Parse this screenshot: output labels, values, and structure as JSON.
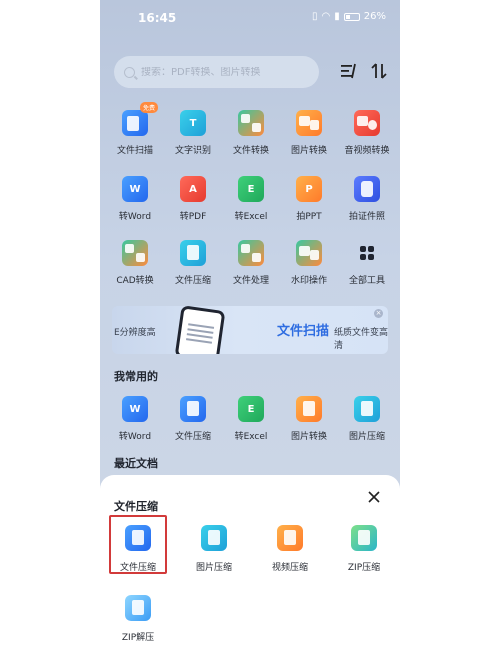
{
  "status": {
    "time": "16:45",
    "battery": "26%"
  },
  "search": {
    "placeholder": "搜索：PDF转换、图片转换"
  },
  "tools_row1": [
    {
      "label": "文件扫描",
      "icon": "scan-icon",
      "color": "ic-blue",
      "badge": "免费"
    },
    {
      "label": "文字识别",
      "icon": "text-recognition-icon",
      "color": "ic-cyan",
      "glyph": "T"
    },
    {
      "label": "文件转换",
      "icon": "file-convert-icon",
      "color": "ic-multi"
    },
    {
      "label": "图片转换",
      "icon": "image-convert-icon",
      "color": "ic-orange"
    },
    {
      "label": "音视频转换",
      "icon": "av-convert-icon",
      "color": "ic-red"
    }
  ],
  "tools_row2": [
    {
      "label": "转Word",
      "icon": "word-icon",
      "color": "ic-blue",
      "glyph": "W"
    },
    {
      "label": "转PDF",
      "icon": "pdf-icon",
      "color": "ic-red",
      "glyph": "A"
    },
    {
      "label": "转Excel",
      "icon": "excel-icon",
      "color": "ic-green",
      "glyph": "E"
    },
    {
      "label": "拍PPT",
      "icon": "ppt-icon",
      "color": "ic-orange",
      "glyph": "P"
    },
    {
      "label": "拍证件照",
      "icon": "id-photo-icon",
      "color": "ic-navy"
    }
  ],
  "tools_row3": [
    {
      "label": "CAD转换",
      "icon": "cad-icon",
      "color": "ic-multi"
    },
    {
      "label": "文件压缩",
      "icon": "compress-icon",
      "color": "ic-cyan"
    },
    {
      "label": "文件处理",
      "icon": "file-process-icon",
      "color": "ic-multi"
    },
    {
      "label": "水印操作",
      "icon": "watermark-icon",
      "color": "ic-multi"
    },
    {
      "label": "全部工具",
      "icon": "all-tools-icon",
      "color": "ic-dark"
    }
  ],
  "banner": {
    "left_text": "E分辨度高",
    "title": "文件扫描",
    "subtitle": "纸质文件变高清"
  },
  "favorites": {
    "title": "我常用的",
    "items": [
      {
        "label": "转Word",
        "icon": "word-icon",
        "color": "ic-blue",
        "glyph": "W"
      },
      {
        "label": "文件压缩",
        "icon": "compress-icon",
        "color": "ic-blue"
      },
      {
        "label": "转Excel",
        "icon": "excel-icon",
        "color": "ic-green",
        "glyph": "E"
      },
      {
        "label": "图片转换",
        "icon": "image-convert-icon",
        "color": "ic-orange"
      },
      {
        "label": "图片压缩",
        "icon": "image-compress-icon",
        "color": "ic-cyan"
      }
    ]
  },
  "recent": {
    "title": "最近文档"
  },
  "sheet": {
    "title": "文件压缩",
    "options": [
      {
        "label": "文件压缩",
        "icon": "file-compress-icon",
        "color": "ic-blue",
        "selected": true
      },
      {
        "label": "图片压缩",
        "icon": "image-compress-icon",
        "color": "ic-cyan"
      },
      {
        "label": "视频压缩",
        "icon": "video-compress-icon",
        "color": "ic-orange"
      },
      {
        "label": "ZIP压缩",
        "icon": "zip-compress-icon",
        "color": "ic-zip"
      },
      {
        "label": "ZIP解压",
        "icon": "zip-extract-icon",
        "color": "ic-lightblue"
      }
    ]
  }
}
